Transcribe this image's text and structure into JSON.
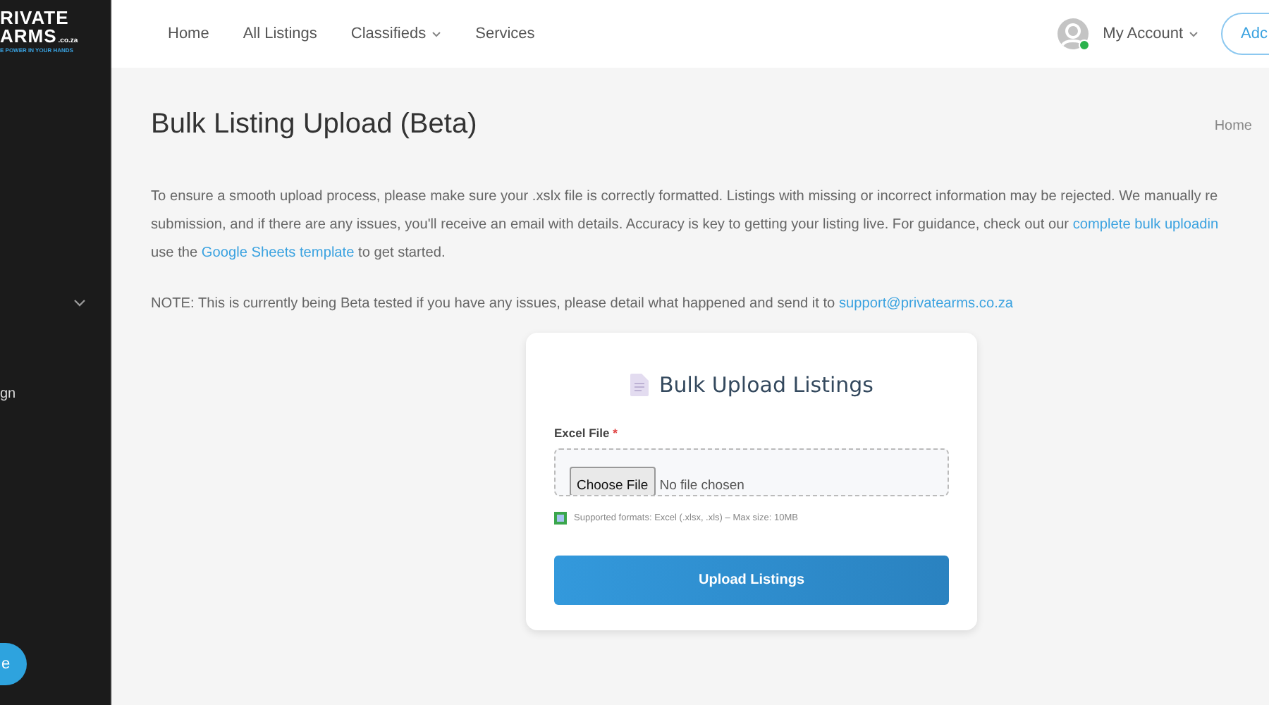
{
  "logo": {
    "line1": "RIVATE",
    "line2": "ARMS",
    "domain": ".co.za",
    "tagline": "E POWER IN YOUR HANDS"
  },
  "sidebar": {
    "items": [
      {
        "label": "gn"
      }
    ],
    "button": "e"
  },
  "nav": [
    {
      "label": "Home",
      "dropdown": false
    },
    {
      "label": "All Listings",
      "dropdown": false
    },
    {
      "label": "Classifieds",
      "dropdown": true
    },
    {
      "label": "Services",
      "dropdown": false
    }
  ],
  "account": {
    "label": "My Account",
    "online": true
  },
  "add_button": "Adc",
  "page_title": "Bulk Listing Upload (Beta)",
  "breadcrumb": "Home",
  "intro": [
    [
      {
        "text": "To ensure a smooth upload process, please make sure your .xslx file is correctly formatted. Listings with missing or incorrect information may be rejected. We manually re",
        "link": false
      }
    ],
    [
      {
        "text": "submission, and if there are any issues, you'll receive an email with details. Accuracy is key to getting your listing live. For guidance, check out our ",
        "link": false
      },
      {
        "text": "complete bulk uploadin",
        "link": true
      }
    ],
    [
      {
        "text": "use the ",
        "link": false
      },
      {
        "text": "Google Sheets template",
        "link": true
      },
      {
        "text": " to get started.",
        "link": false
      }
    ]
  ],
  "note": [
    {
      "text": "NOTE: This is currently being Beta tested if you have any issues, please detail what happened and send it to ",
      "link": false
    },
    {
      "text": "support@privatearms.co.za",
      "link": true
    }
  ],
  "card": {
    "title": "Bulk Upload Listings",
    "field_label": "Excel File",
    "required_mark": "*",
    "choose_button": "Choose File",
    "file_status": "No file chosen",
    "hint": "Supported formats: Excel (.xlsx, .xls) – Max size: 10MB",
    "submit": "Upload Listings"
  }
}
